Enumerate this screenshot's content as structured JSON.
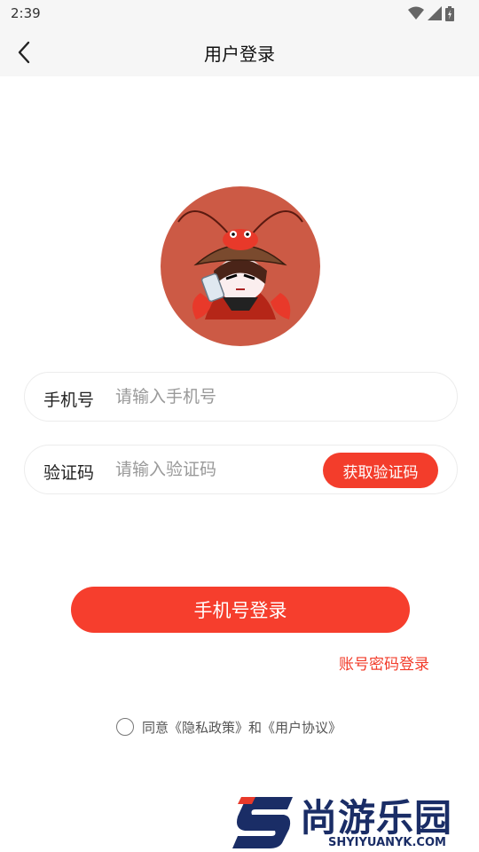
{
  "status_bar": {
    "time": "2:39"
  },
  "header": {
    "title": "用户登录"
  },
  "form": {
    "phone": {
      "label": "手机号",
      "placeholder": "请输入手机号",
      "value": ""
    },
    "code": {
      "label": "验证码",
      "placeholder": "请输入验证码",
      "value": "",
      "button": "获取验证码"
    }
  },
  "actions": {
    "login_label": "手机号登录",
    "password_login": "账号密码登录"
  },
  "agreement": {
    "text": "同意《隐私政策》和《用户协议》",
    "checked": false
  },
  "watermark": {
    "text": "尚游乐园",
    "sub": "SHYIYUANYK.COM"
  },
  "colors": {
    "accent": "#f63e2d",
    "avatar_bg": "#cc5a45",
    "header_bg": "#f6f6f6"
  }
}
